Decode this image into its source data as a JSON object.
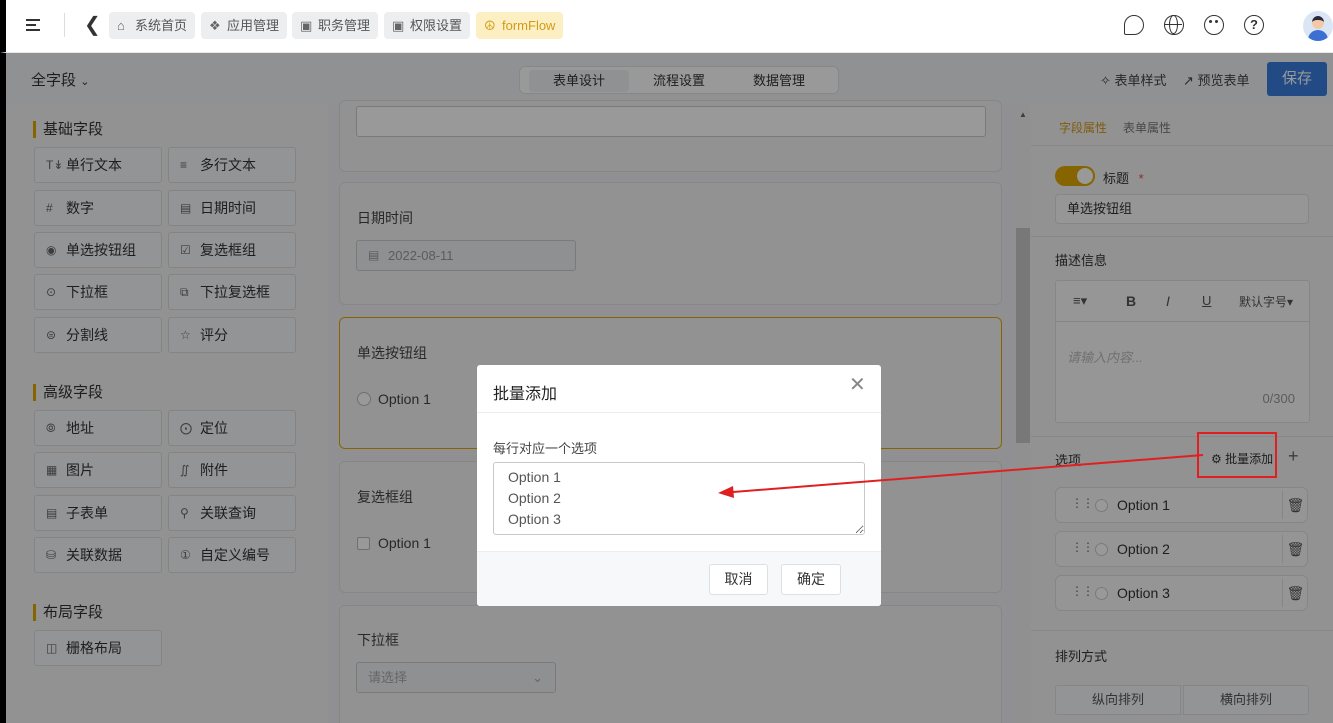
{
  "header": {
    "tabs": [
      {
        "label": "系统首页",
        "icon": "home-icon"
      },
      {
        "label": "应用管理",
        "icon": "apps-icon"
      },
      {
        "label": "职务管理",
        "icon": "badge-icon"
      },
      {
        "label": "权限设置",
        "icon": "badge-icon"
      },
      {
        "label": "formFlow",
        "icon": "flow-icon"
      }
    ],
    "active_tab": "formFlow",
    "accent_color": "#e0a800"
  },
  "toolbar": {
    "field_select": "全字段",
    "segments": [
      "表单设计",
      "流程设置",
      "数据管理"
    ],
    "active_segment": "表单设计",
    "form_style": "表单样式",
    "preview_form": "预览表单",
    "save": "保存",
    "save_color": "#3a7de0"
  },
  "left_panel": {
    "basic_title": "基础字段",
    "basic_fields": [
      {
        "label": "单行文本",
        "icon": "text-icon"
      },
      {
        "label": "多行文本",
        "icon": "multiline-icon"
      },
      {
        "label": "数字",
        "icon": "hash-icon"
      },
      {
        "label": "日期时间",
        "icon": "calendar-icon"
      },
      {
        "label": "单选按钮组",
        "icon": "radio-icon"
      },
      {
        "label": "复选框组",
        "icon": "checkbox-icon"
      },
      {
        "label": "下拉框",
        "icon": "dropdown-icon"
      },
      {
        "label": "下拉复选框",
        "icon": "multi-dropdown-icon"
      },
      {
        "label": "分割线",
        "icon": "divider-icon"
      },
      {
        "label": "评分",
        "icon": "star-icon"
      }
    ],
    "advanced_title": "高级字段",
    "advanced_fields": [
      {
        "label": "地址",
        "icon": "compass-icon"
      },
      {
        "label": "定位",
        "icon": "locate-icon"
      },
      {
        "label": "图片",
        "icon": "image-icon"
      },
      {
        "label": "附件",
        "icon": "paperclip-icon"
      },
      {
        "label": "子表单",
        "icon": "table-icon"
      },
      {
        "label": "关联查询",
        "icon": "search-icon"
      },
      {
        "label": "关联数据",
        "icon": "database-icon"
      },
      {
        "label": "自定义编号",
        "icon": "number-icon"
      }
    ],
    "layout_title": "布局字段",
    "layout_fields": [
      {
        "label": "栅格布局",
        "icon": "grid-icon"
      }
    ]
  },
  "canvas": {
    "date_label": "日期时间",
    "date_value": "2022-08-11",
    "radio_label": "单选按钮组",
    "radio_option": "Option 1",
    "checkbox_label": "复选框组",
    "checkbox_option": "Option 1",
    "select_label": "下拉框",
    "select_placeholder": "请选择"
  },
  "right_panel": {
    "tabs": [
      "字段属性",
      "表单属性"
    ],
    "title_label": "标题",
    "title_value": "单选按钮组",
    "desc_label": "描述信息",
    "editor_font": "默认字号",
    "editor_placeholder": "请输入内容...",
    "editor_count": "0/300",
    "options_label": "选项",
    "batch_add": "批量添加",
    "options": [
      "Option 1",
      "Option 2",
      "Option 3"
    ],
    "arrange_label": "排列方式",
    "arrange_options": [
      "纵向排列",
      "横向排列"
    ]
  },
  "dialog": {
    "title": "批量添加",
    "hint": "每行对应一个选项",
    "textarea_value": "Option 1\nOption 2\nOption 3",
    "cancel": "取消",
    "confirm": "确定"
  }
}
